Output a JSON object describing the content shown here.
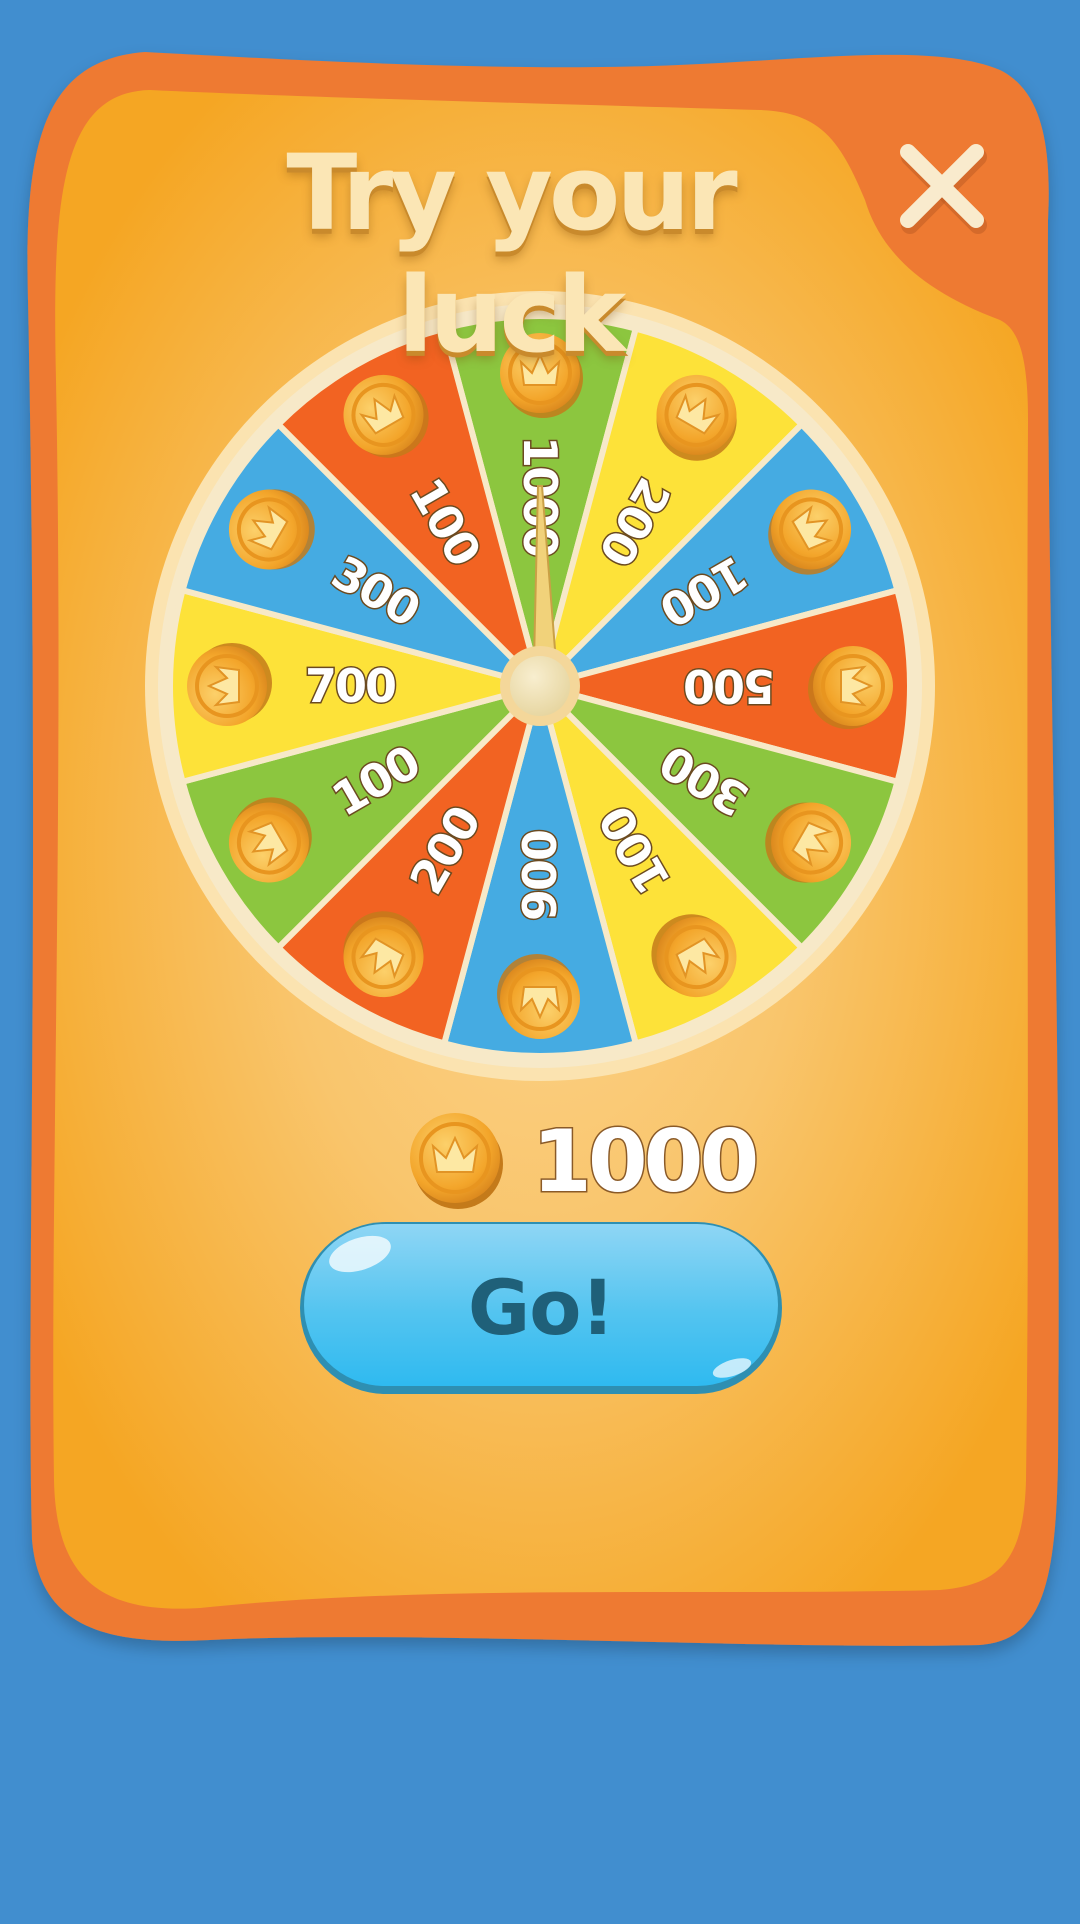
{
  "title": "Try your luck",
  "close_icon": "close-icon",
  "wheel": {
    "segments": [
      {
        "value": "1000",
        "color": "#8cc63f"
      },
      {
        "value": "200",
        "color": "#fde239"
      },
      {
        "value": "100",
        "color": "#45abe2"
      },
      {
        "value": "500",
        "color": "#f26322"
      },
      {
        "value": "300",
        "color": "#8cc63f"
      },
      {
        "value": "100",
        "color": "#fde239"
      },
      {
        "value": "900",
        "color": "#45abe2"
      },
      {
        "value": "200",
        "color": "#f26322"
      },
      {
        "value": "100",
        "color": "#8cc63f"
      },
      {
        "value": "700",
        "color": "#fde239"
      },
      {
        "value": "300",
        "color": "#45abe2"
      },
      {
        "value": "100",
        "color": "#f26322"
      }
    ],
    "coin_icon": "crown-coin-icon"
  },
  "balance": {
    "value": "1000",
    "icon": "crown-coin-icon"
  },
  "go_button": {
    "label": "Go!"
  },
  "colors": {
    "background": "#418ecf",
    "panel_outer": "#ee7a33",
    "panel_inner": "#f7ad2a",
    "button": "#3fbfec"
  }
}
